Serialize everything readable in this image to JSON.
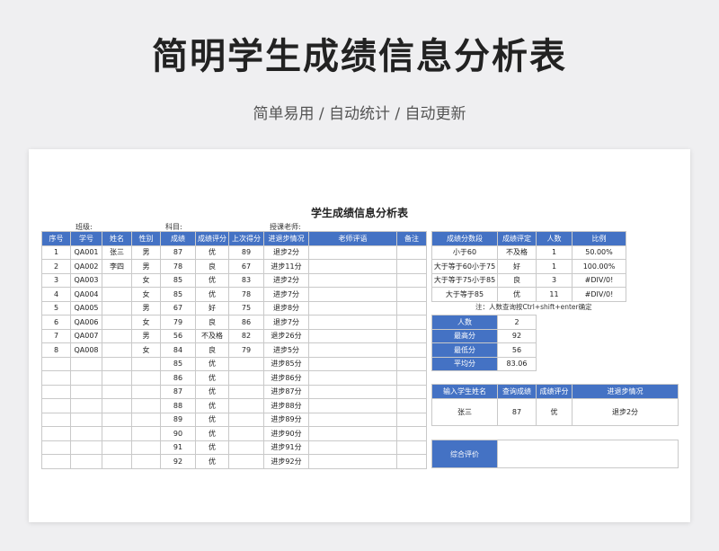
{
  "header": {
    "title": "简明学生成绩信息分析表",
    "subtitle": "简单易用 / 自动统计 / 自动更新"
  },
  "sheet": {
    "title": "学生成绩信息分析表",
    "meta": {
      "class_label": "班级:",
      "subject_label": "科目:",
      "teacher_label": "授课老师:"
    },
    "main_table": {
      "headers": [
        "序号",
        "学号",
        "姓名",
        "性别",
        "成绩",
        "成绩评分",
        "上次得分",
        "进退步情况",
        "老师评语",
        "备注"
      ],
      "rows": [
        [
          "1",
          "QA001",
          "张三",
          "男",
          "87",
          "优",
          "89",
          "退步2分",
          "",
          ""
        ],
        [
          "2",
          "QA002",
          "李四",
          "男",
          "78",
          "良",
          "67",
          "进步11分",
          "",
          ""
        ],
        [
          "3",
          "QA003",
          "",
          "女",
          "85",
          "优",
          "83",
          "进步2分",
          "",
          ""
        ],
        [
          "4",
          "QA004",
          "",
          "女",
          "85",
          "优",
          "78",
          "进步7分",
          "",
          ""
        ],
        [
          "5",
          "QA005",
          "",
          "男",
          "67",
          "好",
          "75",
          "退步8分",
          "",
          ""
        ],
        [
          "6",
          "QA006",
          "",
          "女",
          "79",
          "良",
          "86",
          "退步7分",
          "",
          ""
        ],
        [
          "7",
          "QA007",
          "",
          "男",
          "56",
          "不及格",
          "82",
          "退步26分",
          "",
          ""
        ],
        [
          "8",
          "QA008",
          "",
          "女",
          "84",
          "良",
          "79",
          "进步5分",
          "",
          ""
        ],
        [
          "",
          "",
          "",
          "",
          "85",
          "优",
          "",
          "进步85分",
          "",
          ""
        ],
        [
          "",
          "",
          "",
          "",
          "86",
          "优",
          "",
          "进步86分",
          "",
          ""
        ],
        [
          "",
          "",
          "",
          "",
          "87",
          "优",
          "",
          "进步87分",
          "",
          ""
        ],
        [
          "",
          "",
          "",
          "",
          "88",
          "优",
          "",
          "进步88分",
          "",
          ""
        ],
        [
          "",
          "",
          "",
          "",
          "89",
          "优",
          "",
          "进步89分",
          "",
          ""
        ],
        [
          "",
          "",
          "",
          "",
          "90",
          "优",
          "",
          "进步90分",
          "",
          ""
        ],
        [
          "",
          "",
          "",
          "",
          "91",
          "优",
          "",
          "进步91分",
          "",
          ""
        ],
        [
          "",
          "",
          "",
          "",
          "92",
          "优",
          "",
          "进步92分",
          "",
          ""
        ]
      ]
    },
    "distribution": {
      "headers": [
        "成绩分数段",
        "成绩评定",
        "人数",
        "比例"
      ],
      "rows": [
        [
          "小于60",
          "不及格",
          "1",
          "50.00%"
        ],
        [
          "大于等于60小于75",
          "好",
          "1",
          "100.00%"
        ],
        [
          "大于等于75小于85",
          "良",
          "3",
          "#DIV/0!"
        ],
        [
          "大于等于85",
          "优",
          "11",
          "#DIV/0!"
        ]
      ]
    },
    "note": "注：人数查询按Ctrl+shift+enter确定",
    "stats": [
      {
        "label": "人数",
        "value": "2"
      },
      {
        "label": "最高分",
        "value": "92"
      },
      {
        "label": "最低分",
        "value": "56"
      },
      {
        "label": "平均分",
        "value": "83.06"
      }
    ],
    "query": {
      "headers": [
        "输入学生姓名",
        "查询成绩",
        "成绩评分",
        "进退步情况"
      ],
      "row": [
        "张三",
        "87",
        "优",
        "退步2分"
      ]
    },
    "evaluation": {
      "label": "综合评价",
      "value": ""
    }
  }
}
